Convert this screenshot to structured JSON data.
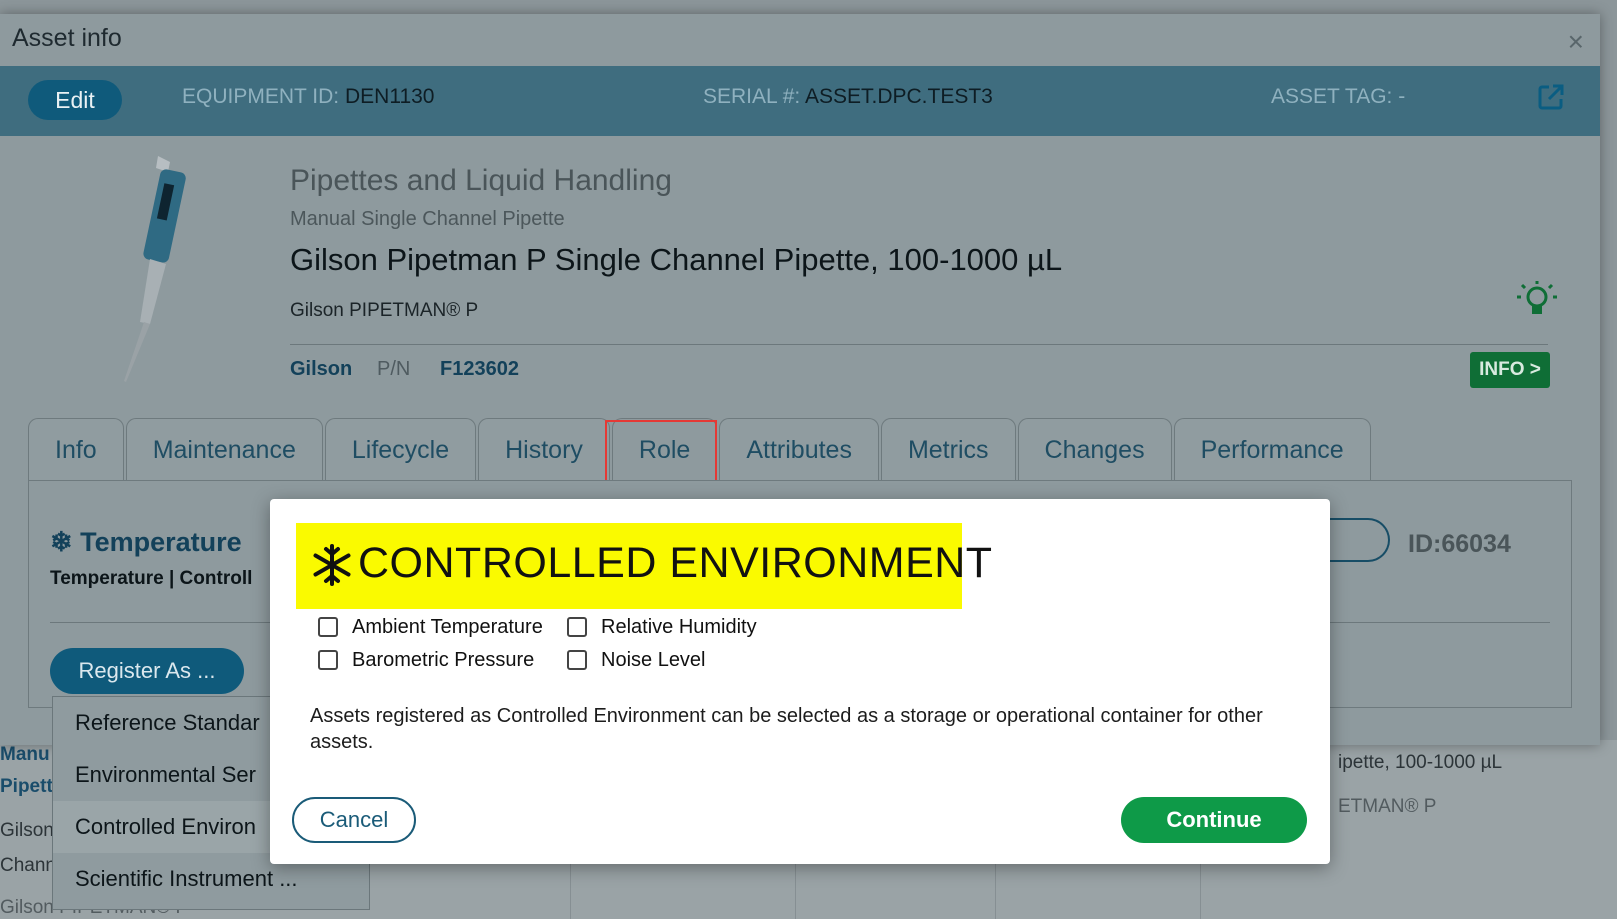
{
  "window": {
    "title": "Asset info",
    "close_glyph": "×"
  },
  "idbar": {
    "edit_label": "Edit",
    "equipment_id_label": "EQUIPMENT ID:",
    "equipment_id_value": "DEN1130",
    "serial_label": "SERIAL #:",
    "serial_value": "ASSET.DPC.TEST3",
    "asset_tag_label": "ASSET TAG:",
    "asset_tag_value": "-"
  },
  "asset": {
    "category": "Pipettes and Liquid Handling",
    "subcategory": "Manual Single Channel Pipette",
    "title": "Gilson Pipetman P Single Channel Pipette, 100-1000 µL",
    "model": "Gilson PIPETMAN® P",
    "manufacturer": "Gilson",
    "pn_label": "P/N",
    "pn_value": "F123602",
    "info_button": "INFO >"
  },
  "tabs": [
    "Info",
    "Maintenance",
    "Lifecycle",
    "History",
    "Role",
    "Attributes",
    "Metrics",
    "Changes",
    "Performance"
  ],
  "active_tab": "Role",
  "role_panel": {
    "title": "Temperature",
    "subtitle": "Temperature | Controll",
    "register_button": "Register As ...",
    "id_code": "ID:66034"
  },
  "register_menu": {
    "items": [
      "Reference Standar",
      "Environmental Ser",
      "Controlled Environ",
      "Scientific Instrument ..."
    ]
  },
  "modal": {
    "banner_title": "CONTROLLED ENVIRONMENT",
    "checkboxes": [
      {
        "label": "Ambient Temperature",
        "checked": false
      },
      {
        "label": "Relative Humidity",
        "checked": false
      },
      {
        "label": "Barometric Pressure",
        "checked": false
      },
      {
        "label": "Noise Level",
        "checked": false
      }
    ],
    "note": "Assets registered as Controlled Environment can be selected as a storage or operational container for other assets.",
    "cancel_label": "Cancel",
    "continue_label": "Continue"
  },
  "background": {
    "left_fragments": [
      "Manu",
      "Pipett",
      "Gilson",
      "Chann",
      "Gilson PIPETMAN® P"
    ],
    "right_fragments": [
      "ipette, 100-1000 µL",
      "ETMAN® P"
    ]
  },
  "colors": {
    "banner_yellow": "#fafa00",
    "continue_green": "#0e9a48",
    "primary_blue": "#0f5a7b",
    "highlight_red": "#e53935",
    "info_green": "#0f6e36"
  },
  "icons": {
    "snowflake": "snowflake-icon",
    "close": "close-icon",
    "external_link": "external-link-icon",
    "lightbulb": "lightbulb-icon"
  }
}
